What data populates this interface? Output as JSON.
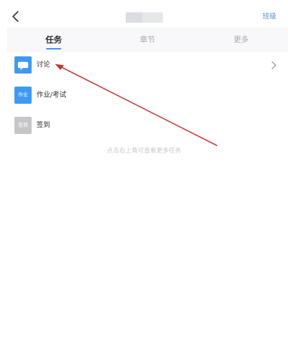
{
  "header": {
    "right_link": "班级"
  },
  "tabs": [
    {
      "label": "任务",
      "active": true
    },
    {
      "label": "章节",
      "active": false
    },
    {
      "label": "更多",
      "active": false
    }
  ],
  "tasks": [
    {
      "label": "讨论",
      "icon": "chat-bubble-icon",
      "icon_text": "",
      "color": "#3e9af1"
    },
    {
      "label": "作业/考试",
      "icon": "homework-icon",
      "icon_text": "作业",
      "color": "#3e9af1"
    },
    {
      "label": "签到",
      "icon": "sign-in-icon",
      "icon_text": "签到",
      "color": "#c6c6c9"
    }
  ],
  "empty_hint": "点击右上角可查看更多任务",
  "colors": {
    "accent": "#3a8ff0",
    "annotation_arrow": "#c0393b"
  }
}
